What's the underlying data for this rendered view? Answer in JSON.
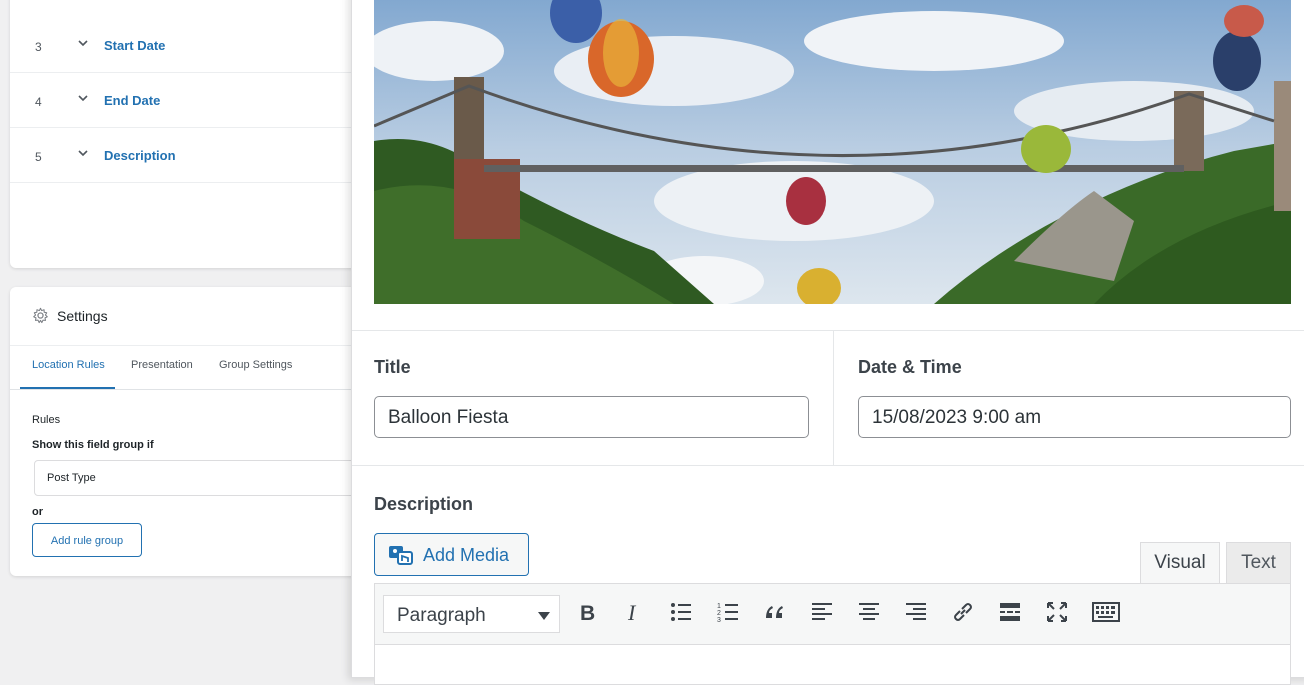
{
  "field_list": {
    "rows": [
      {
        "num": "3",
        "label": "Start Date"
      },
      {
        "num": "4",
        "label": "End Date"
      },
      {
        "num": "5",
        "label": "Description"
      }
    ]
  },
  "settings": {
    "title": "Settings",
    "tabs": [
      "Location Rules",
      "Presentation",
      "Group Settings"
    ],
    "active_tab": "Location Rules",
    "rules_label": "Rules",
    "show_if_label": "Show this field group if",
    "rule_select_value": "Post Type",
    "or_label": "or",
    "add_rule_group_label": "Add rule group"
  },
  "editor": {
    "title_label": "Title",
    "title_value": "Balloon Fiesta",
    "date_label": "Date & Time",
    "date_value": "15/08/2023 9:00 am",
    "description_label": "Description",
    "add_media_label": "Add Media",
    "tabs": {
      "visual": "Visual",
      "text": "Text"
    },
    "active_tab": "Visual",
    "format_select_value": "Paragraph",
    "toolbar_icons": [
      "bold-icon",
      "italic-icon",
      "bullet-list-icon",
      "numbered-list-icon",
      "blockquote-icon",
      "align-left-icon",
      "align-center-icon",
      "align-right-icon",
      "link-icon",
      "read-more-icon",
      "fullscreen-icon",
      "keyboard-toolbar-icon"
    ]
  },
  "colors": {
    "accent": "#2271b1",
    "text": "#1d2327",
    "border": "#dcdcde"
  }
}
